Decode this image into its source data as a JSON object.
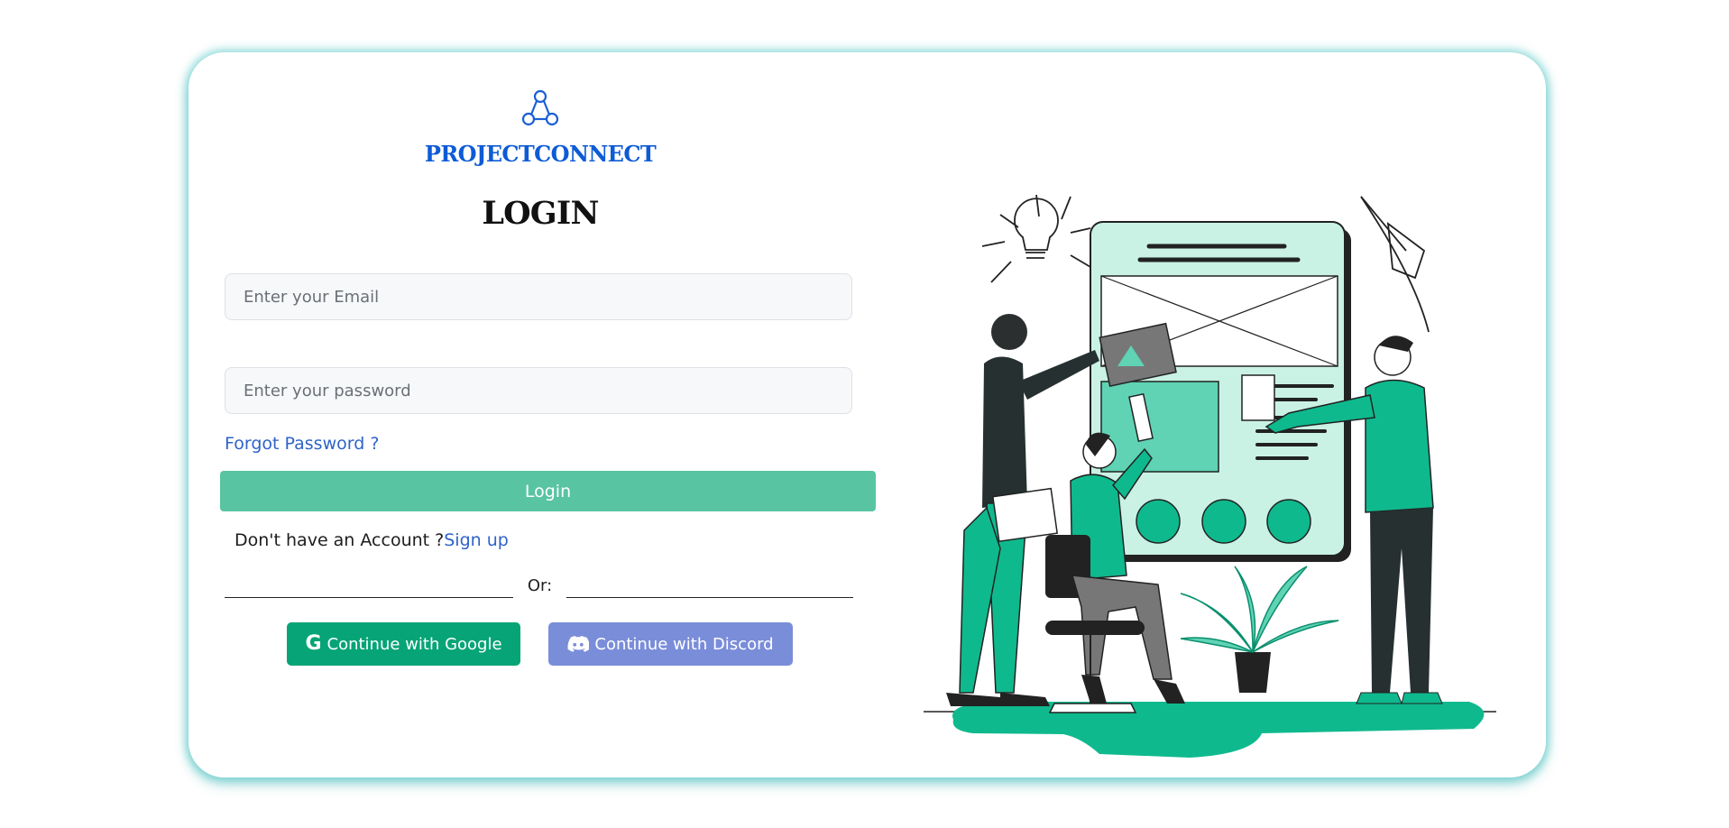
{
  "brand": {
    "name": "PROJECTCONNECT",
    "logo_icon": "network-nodes-icon",
    "color": "#0d5bd6"
  },
  "login": {
    "title": "LOGIN",
    "email_placeholder": "Enter your Email",
    "password_placeholder": "Enter your password",
    "forgot_password": "Forgot Password ?",
    "submit_label": "Login",
    "no_account_text": "Don't have an Account ?",
    "signup_link": "Sign up",
    "divider_text": "Or:"
  },
  "social": {
    "google": {
      "label": "Continue with Google",
      "icon": "google-icon",
      "color": "#06a476"
    },
    "discord": {
      "label": "Continue with Discord",
      "icon": "discord-icon",
      "color": "#7a8dd9"
    }
  },
  "colors": {
    "accent": "#58c4a2",
    "link": "#2f63c8",
    "card_shadow": "#3abebe"
  },
  "illustration": {
    "description_icon": "team-design-illustration"
  }
}
